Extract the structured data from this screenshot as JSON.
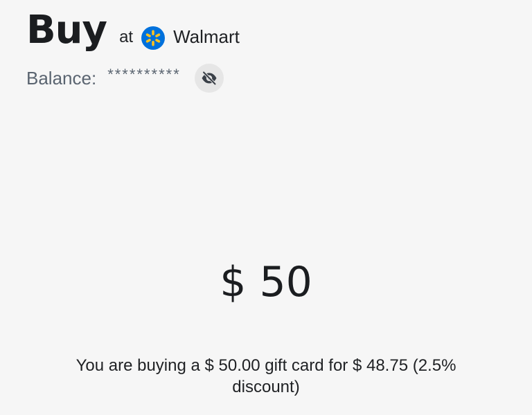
{
  "header": {
    "title": "Buy",
    "at_label": "at",
    "merchant_name": "Walmart",
    "merchant_logo_icon": "walmart-spark-icon",
    "merchant_logo_colors": {
      "background": "#0071dc",
      "spark": "#ffc220"
    }
  },
  "balance": {
    "label": "Balance:",
    "value": "**********",
    "toggle_icon": "eye-slash-icon"
  },
  "amount": {
    "display": "$ 50"
  },
  "summary": {
    "text": "You are buying a $ 50.00 gift card for $ 48.75 (2.5% discount)"
  }
}
